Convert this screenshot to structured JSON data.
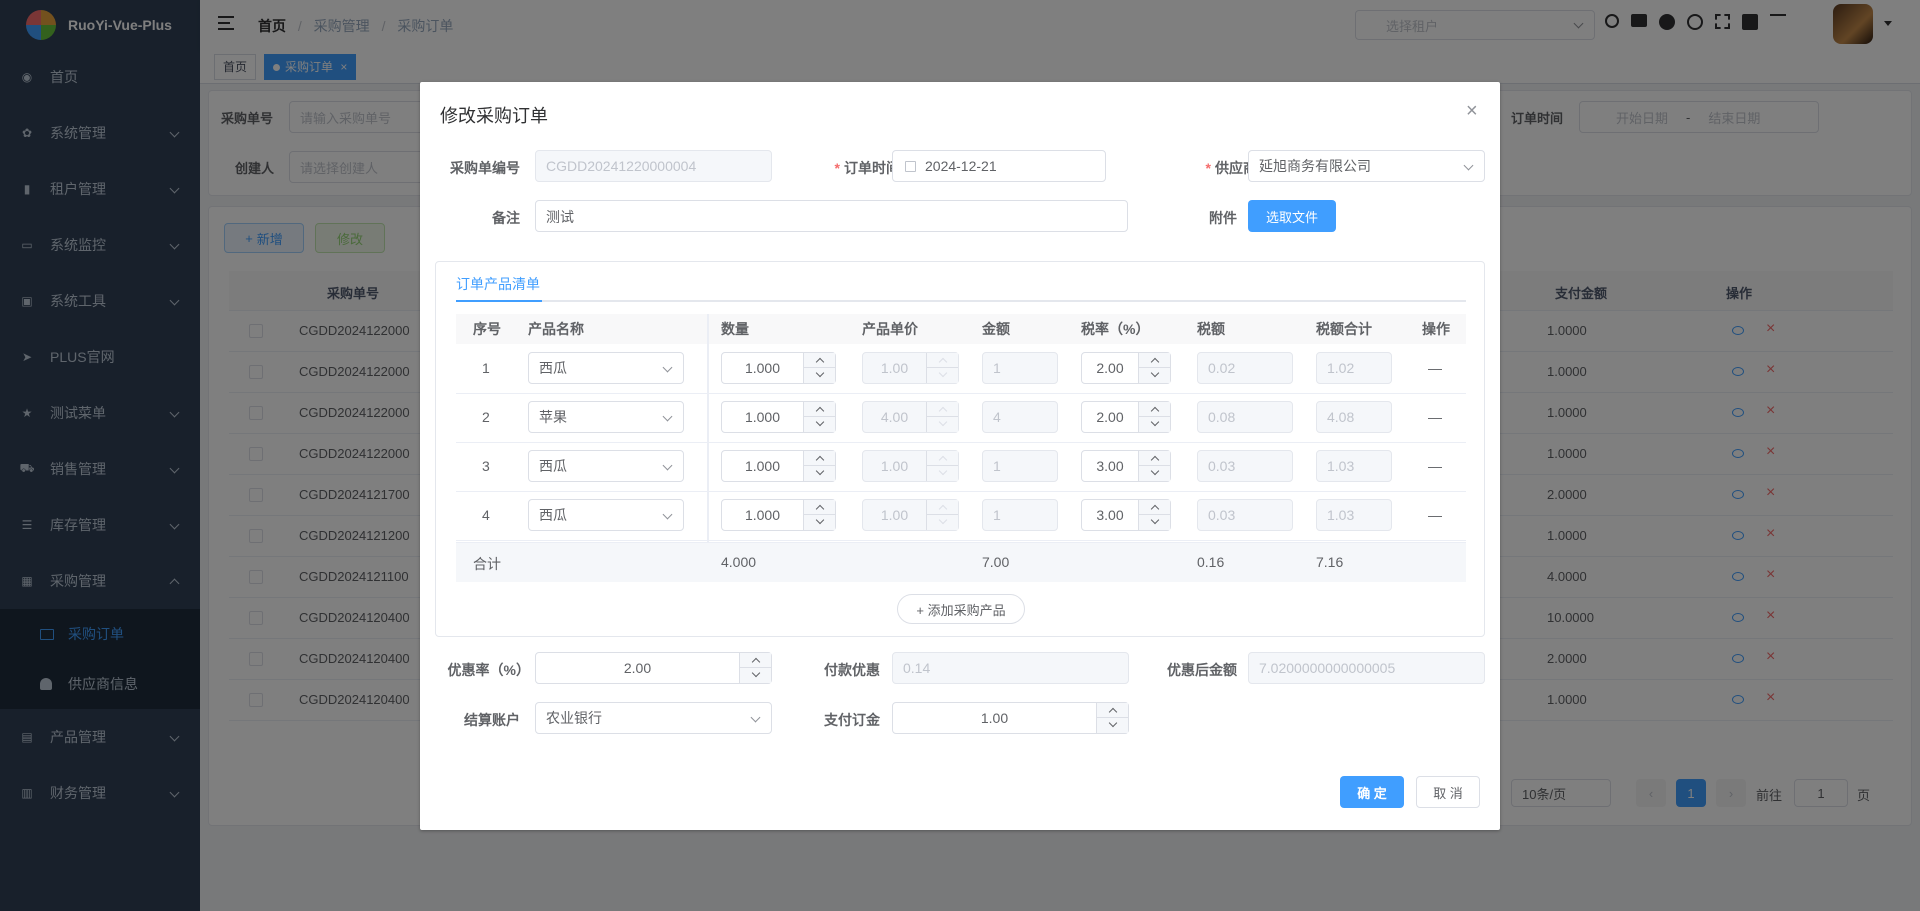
{
  "app": {
    "title": "RuoYi-Vue-Plus"
  },
  "sidebar": {
    "items": [
      {
        "label": "首页",
        "icon": "dashboard-icon"
      },
      {
        "label": "系统管理",
        "icon": "gear-icon"
      },
      {
        "label": "租户管理",
        "icon": "chart-icon"
      },
      {
        "label": "系统监控",
        "icon": "monitor-icon"
      },
      {
        "label": "系统工具",
        "icon": "toolbox-icon"
      },
      {
        "label": "PLUS官网",
        "icon": "send-icon"
      },
      {
        "label": "测试菜单",
        "icon": "star-icon"
      },
      {
        "label": "销售管理",
        "icon": "cart-icon"
      },
      {
        "label": "库存管理",
        "icon": "list-icon"
      },
      {
        "label": "采购管理",
        "icon": "table-icon"
      },
      {
        "label": "产品管理",
        "icon": "building-icon"
      },
      {
        "label": "财务管理",
        "icon": "book-icon"
      }
    ],
    "sub_items": [
      {
        "label": "采购订单",
        "icon": "monitor-icon"
      },
      {
        "label": "供应商信息",
        "icon": "user-icon"
      }
    ]
  },
  "header": {
    "breadcrumb": [
      "首页",
      "采购管理",
      "采购订单"
    ],
    "tenant_placeholder": "选择租户"
  },
  "tags": [
    "首页",
    "采购订单"
  ],
  "search": {
    "order_no_label": "采购单号",
    "order_no_placeholder": "请输入采购单号",
    "creator_label": "创建人",
    "creator_placeholder": "请选择创建人",
    "order_time_label": "订单时间",
    "start_placeholder": "开始日期",
    "range_sep": "-",
    "end_placeholder": "结束日期"
  },
  "toolbar": {
    "add": "新增",
    "edit": "修改"
  },
  "list": {
    "headers": [
      "采购单号",
      "支付金额",
      "操作"
    ],
    "rows": [
      {
        "no": "CGDD2024122000",
        "pay": "1.0000"
      },
      {
        "no": "CGDD2024122000",
        "pay": "1.0000"
      },
      {
        "no": "CGDD2024122000",
        "pay": "1.0000"
      },
      {
        "no": "CGDD2024122000",
        "pay": "1.0000"
      },
      {
        "no": "CGDD2024121700",
        "pay": "2.0000"
      },
      {
        "no": "CGDD2024121200",
        "pay": "1.0000"
      },
      {
        "no": "CGDD2024121100",
        "pay": "4.0000"
      },
      {
        "no": "CGDD2024120400",
        "pay": "10.0000"
      },
      {
        "no": "CGDD2024120400",
        "pay": "2.0000"
      },
      {
        "no": "CGDD2024120400",
        "pay": "1.0000"
      }
    ]
  },
  "pagination": {
    "page_size": "10条/页",
    "current": "1",
    "goto_label": "前往",
    "goto_value": "1",
    "page_suffix": "页"
  },
  "dialog": {
    "title": "修改采购订单",
    "order_no_label": "采购单编号",
    "order_no_value": "CGDD20241220000004",
    "order_time_label": "订单时间",
    "order_time_value": "2024-12-21",
    "supplier_label": "供应商",
    "supplier_value": "延旭商务有限公司",
    "remark_label": "备注",
    "remark_value": "测试",
    "attachment_label": "附件",
    "select_file": "选取文件",
    "tab_label": "订单产品清单",
    "table_headers": [
      "序号",
      "产品名称",
      "数量",
      "产品单价",
      "金额",
      "税率（%）",
      "税额",
      "税额合计",
      "操作"
    ],
    "rows": [
      {
        "idx": "1",
        "product": "西瓜",
        "qty": "1.000",
        "price": "1.00",
        "amount": "1",
        "rate": "2.00",
        "tax": "0.02",
        "total": "1.02",
        "op": "—"
      },
      {
        "idx": "2",
        "product": "苹果",
        "qty": "1.000",
        "price": "4.00",
        "amount": "4",
        "rate": "2.00",
        "tax": "0.08",
        "total": "4.08",
        "op": "—"
      },
      {
        "idx": "3",
        "product": "西瓜",
        "qty": "1.000",
        "price": "1.00",
        "amount": "1",
        "rate": "3.00",
        "tax": "0.03",
        "total": "1.03",
        "op": "—"
      },
      {
        "idx": "4",
        "product": "西瓜",
        "qty": "1.000",
        "price": "1.00",
        "amount": "1",
        "rate": "3.00",
        "tax": "0.03",
        "total": "1.03",
        "op": "—"
      }
    ],
    "summary": {
      "label": "合计",
      "qty": "4.000",
      "amount": "7.00",
      "tax": "0.16",
      "total": "7.16"
    },
    "add_product": "+ 添加采购产品",
    "discount_rate_label": "优惠率（%）",
    "discount_rate_value": "2.00",
    "pay_discount_label": "付款优惠",
    "pay_discount_value": "0.14",
    "after_discount_label": "优惠后金额",
    "after_discount_value": "7.0200000000000005",
    "account_label": "结算账户",
    "account_value": "农业银行",
    "deposit_label": "支付订金",
    "deposit_value": "1.00",
    "confirm": "确 定",
    "cancel": "取 消"
  },
  "colors": {
    "primary": "#409eff",
    "sidebar": "#304156",
    "danger": "#f56c6c",
    "success": "#67c23a"
  }
}
